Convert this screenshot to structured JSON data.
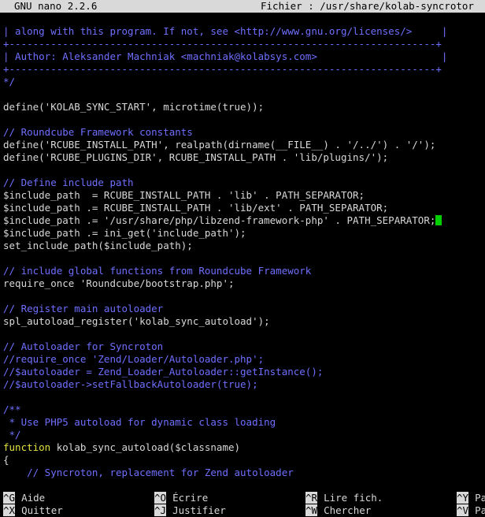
{
  "titlebar": {
    "app": "GNU nano 2.2.6",
    "file": "Fichier : /usr/share/kolab-syncrotor"
  },
  "editor": {
    "lines": [
      {
        "text": "| along with this program. If not, see <http://www.gnu.org/licenses/>     |",
        "kind": "comment"
      },
      {
        "text": "+------------------------------------------------------------------------+",
        "kind": "comment"
      },
      {
        "text": "| Author: Aleksander Machniak <machniak@kolabsys.com>                     |",
        "kind": "comment"
      },
      {
        "text": "+------------------------------------------------------------------------+",
        "kind": "comment"
      },
      {
        "text": "*/",
        "kind": "comment"
      },
      {
        "text": "",
        "kind": "default"
      },
      {
        "text": "define('KOLAB_SYNC_START', microtime(true));",
        "kind": "default"
      },
      {
        "text": "",
        "kind": "default"
      },
      {
        "text": "// Roundcube Framework constants",
        "kind": "comment"
      },
      {
        "text": "define('RCUBE_INSTALL_PATH', realpath(dirname(__FILE__) . '/../') . '/');",
        "kind": "default"
      },
      {
        "text": "define('RCUBE_PLUGINS_DIR', RCUBE_INSTALL_PATH . 'lib/plugins/');",
        "kind": "default"
      },
      {
        "text": "",
        "kind": "default"
      },
      {
        "text": "// Define include path",
        "kind": "comment"
      },
      {
        "text": "$include_path  = RCUBE_INSTALL_PATH . 'lib' . PATH_SEPARATOR;",
        "kind": "default"
      },
      {
        "text": "$include_path .= RCUBE_INSTALL_PATH . 'lib/ext' . PATH_SEPARATOR;",
        "kind": "default"
      },
      {
        "text": "$include_path .= '/usr/share/php/libzend-framework-php' . PATH_SEPARATOR;",
        "kind": "default",
        "cursor": true
      },
      {
        "text": "$include_path .= ini_get('include_path');",
        "kind": "default"
      },
      {
        "text": "set_include_path($include_path);",
        "kind": "default"
      },
      {
        "text": "",
        "kind": "default"
      },
      {
        "text": "// include global functions from Roundcube Framework",
        "kind": "comment"
      },
      {
        "text": "require_once 'Roundcube/bootstrap.php';",
        "kind": "default"
      },
      {
        "text": "",
        "kind": "default"
      },
      {
        "text": "// Register main autoloader",
        "kind": "comment"
      },
      {
        "text": "spl_autoload_register('kolab_sync_autoload');",
        "kind": "default"
      },
      {
        "text": "",
        "kind": "default"
      },
      {
        "text": "// Autoloader for Syncroton",
        "kind": "comment"
      },
      {
        "text": "//require_once 'Zend/Loader/Autoloader.php';",
        "kind": "comment"
      },
      {
        "text": "//$autoloader = Zend_Loader_Autoloader::getInstance();",
        "kind": "comment"
      },
      {
        "text": "//$autoloader->setFallbackAutoloader(true);",
        "kind": "comment"
      },
      {
        "text": "",
        "kind": "default"
      },
      {
        "text": "/**",
        "kind": "comment"
      },
      {
        "text": " * Use PHP5 autoload for dynamic class loading",
        "kind": "comment"
      },
      {
        "text": " */",
        "kind": "comment"
      },
      {
        "text": "function",
        "kind": "keyword",
        "rest": " kolab_sync_autoload($classname)"
      },
      {
        "text": "{",
        "kind": "default"
      },
      {
        "text": "    // Syncroton, replacement for Zend autoloader",
        "kind": "comment"
      }
    ]
  },
  "shortcuts": [
    {
      "key": "^G",
      "label": "Aide",
      "col": 0,
      "row": 0
    },
    {
      "key": "^X",
      "label": "Quitter",
      "col": 0,
      "row": 1
    },
    {
      "key": "^O",
      "label": "Écrire",
      "col": 1,
      "row": 0
    },
    {
      "key": "^J",
      "label": "Justifier",
      "col": 1,
      "row": 1
    },
    {
      "key": "^R",
      "label": "Lire fich.",
      "col": 2,
      "row": 0
    },
    {
      "key": "^W",
      "label": "Chercher",
      "col": 2,
      "row": 1
    },
    {
      "key": "^Y",
      "label": "Pa",
      "col": 3,
      "row": 0
    },
    {
      "key": "^V",
      "label": "Pa",
      "col": 3,
      "row": 1
    }
  ],
  "colors": {
    "comment": "#6f6fff",
    "text": "#d8d8d8",
    "keyword": "#e0e040",
    "cursor": "#00d000",
    "bar": "#d9d9d9"
  }
}
